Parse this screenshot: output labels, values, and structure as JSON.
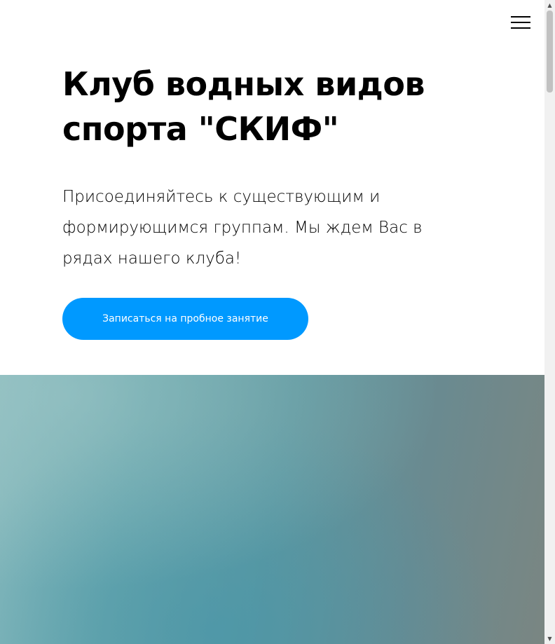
{
  "header": {
    "menu_icon": "hamburger-menu-icon"
  },
  "hero": {
    "title": "Клуб водных видов спорта \"СКИФ\"",
    "subtitle": "Присоединяйтесь к существующим и формирующимся группам. Мы ждем Вас в рядах нашего клуба!",
    "cta_label": "Записаться на пробное занятие"
  },
  "colors": {
    "accent": "#0099ff",
    "text": "#000000",
    "background": "#ffffff"
  },
  "scrollbar": {
    "up_icon": "▲",
    "down_icon": "▼"
  }
}
